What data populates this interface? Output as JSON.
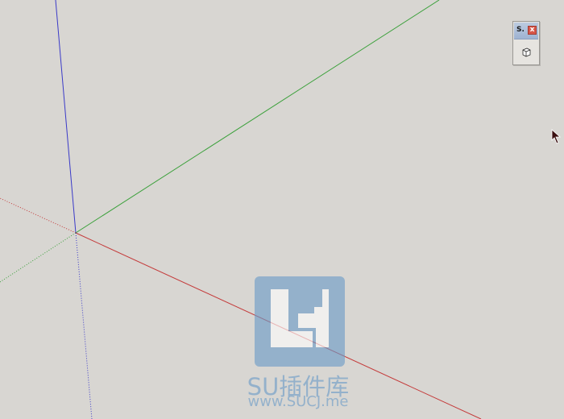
{
  "toolbar": {
    "title": "S.",
    "close_label": "x",
    "button_icon": "cube-icon"
  },
  "viewport": {
    "background": "#d8d6d2",
    "axis_colors": {
      "red": "#c43a3a",
      "green": "#3aa03a",
      "blue": "#3a3ac8"
    }
  },
  "watermark": {
    "title": "SU插件库",
    "url": "www.SUCJ.me",
    "color": "#6b9cc8"
  },
  "cursor": {
    "icon": "arrow-cursor-icon"
  }
}
